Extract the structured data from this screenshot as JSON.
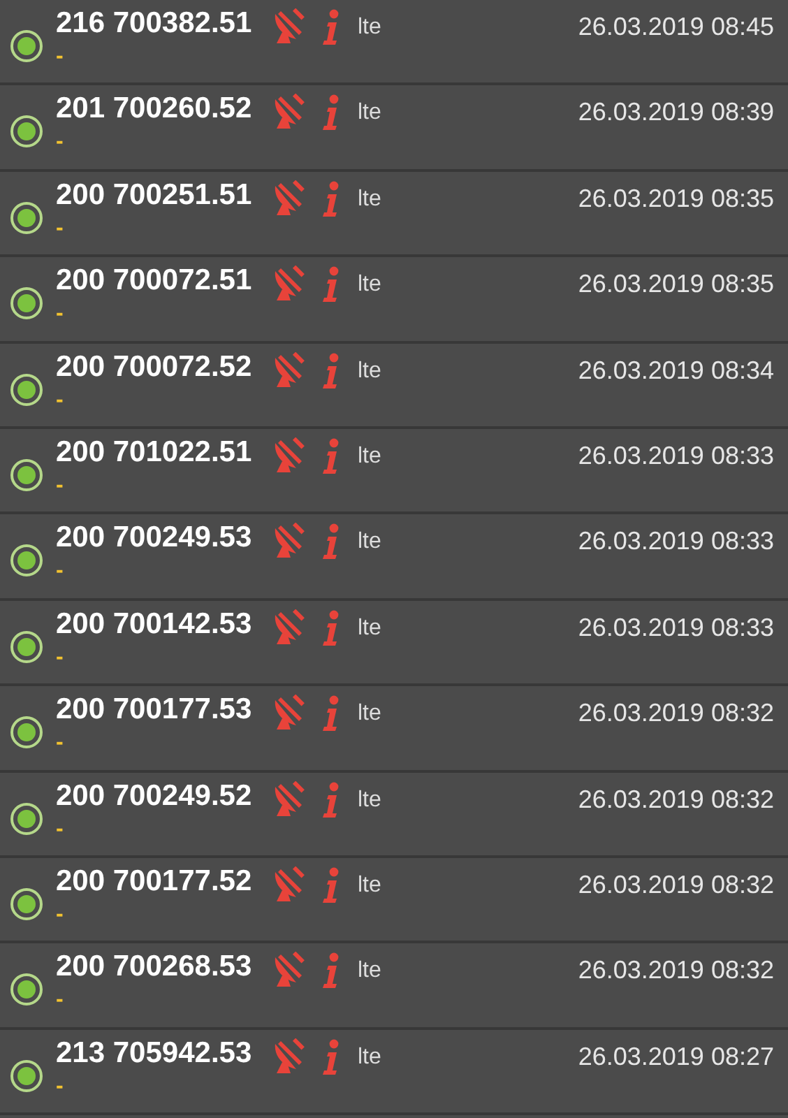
{
  "rows": [
    {
      "number": "216 700382.51",
      "network": "lte",
      "time": "26.03.2019 08:45",
      "note": "-"
    },
    {
      "number": "201 700260.52",
      "network": "lte",
      "time": "26.03.2019 08:39",
      "note": "-"
    },
    {
      "number": "200 700251.51",
      "network": "lte",
      "time": "26.03.2019 08:35",
      "note": "-"
    },
    {
      "number": "200 700072.51",
      "network": "lte",
      "time": "26.03.2019 08:35",
      "note": "-"
    },
    {
      "number": "200 700072.52",
      "network": "lte",
      "time": "26.03.2019 08:34",
      "note": "-"
    },
    {
      "number": "200 701022.51",
      "network": "lte",
      "time": "26.03.2019 08:33",
      "note": "-"
    },
    {
      "number": "200 700249.53",
      "network": "lte",
      "time": "26.03.2019 08:33",
      "note": "-"
    },
    {
      "number": "200 700142.53",
      "network": "lte",
      "time": "26.03.2019 08:33",
      "note": "-"
    },
    {
      "number": "200 700177.53",
      "network": "lte",
      "time": "26.03.2019 08:32",
      "note": "-"
    },
    {
      "number": "200 700249.52",
      "network": "lte",
      "time": "26.03.2019 08:32",
      "note": "-"
    },
    {
      "number": "200 700177.52",
      "network": "lte",
      "time": "26.03.2019 08:32",
      "note": "-"
    },
    {
      "number": "200 700268.53",
      "network": "lte",
      "time": "26.03.2019 08:32",
      "note": "-"
    },
    {
      "number": "213 705942.53",
      "network": "lte",
      "time": "26.03.2019 08:27",
      "note": "-"
    }
  ]
}
